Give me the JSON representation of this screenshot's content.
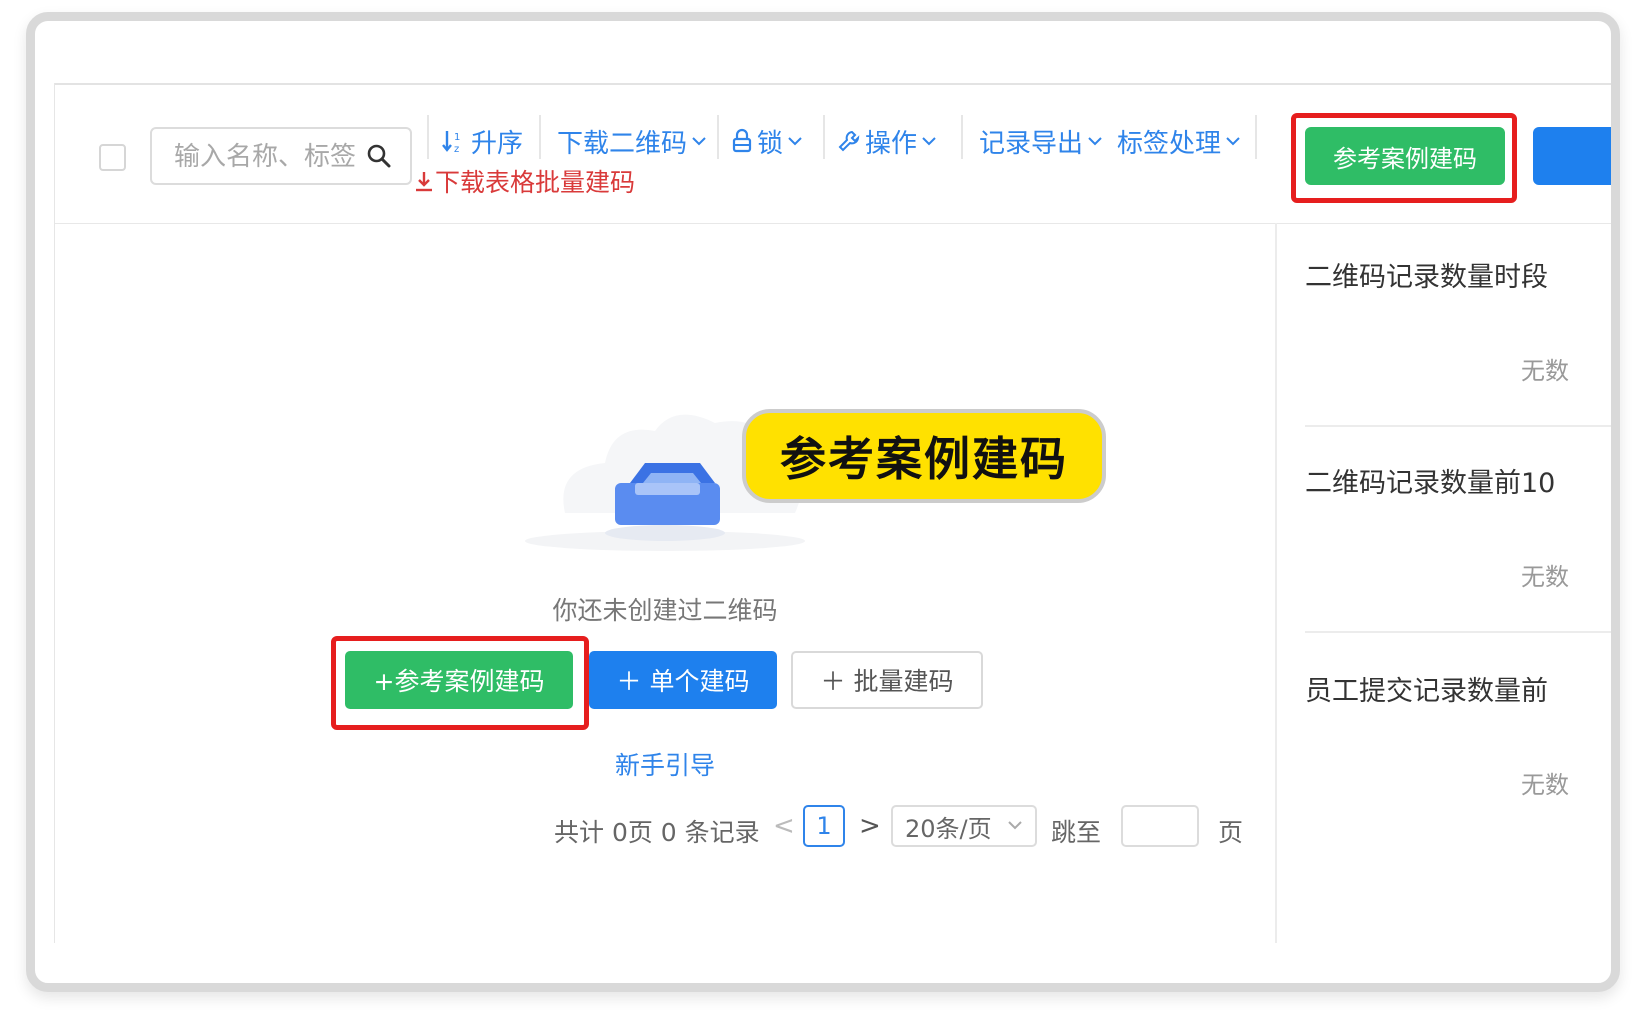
{
  "toolbar": {
    "search_placeholder": "输入名称、标签",
    "sort_label": "升序",
    "download_qr_label": "下载二维码",
    "lock_label": "锁",
    "operate_label": "操作",
    "export_label": "记录导出",
    "tag_label": "标签处理",
    "download_sheet_label": "下载表格批量建码",
    "reference_case_label": "参考案例建码"
  },
  "callout": {
    "text": "参考案例建码"
  },
  "empty_state": {
    "message": "你还未创建过二维码",
    "reference_case_button": "+参考案例建码",
    "single_button": "＋ 单个建码",
    "batch_button": "＋ 批量建码",
    "guide_link": "新手引导"
  },
  "pagination": {
    "total_text": "共计 0页 0 条记录",
    "prev": "<",
    "current_page": "1",
    "next": ">",
    "page_size": "20条/页",
    "jump_label": "跳至",
    "page_suffix": "页"
  },
  "side_panel": {
    "sections": [
      {
        "title": "二维码记录数量时段",
        "empty": "无数"
      },
      {
        "title": "二维码记录数量前10",
        "empty": "无数"
      },
      {
        "title": "员工提交记录数量前",
        "empty": "无数"
      }
    ]
  },
  "colors": {
    "accent_blue": "#2f84ea",
    "green": "#2fbd66",
    "highlight_red": "#e61e1e",
    "callout_yellow": "#ffe100",
    "link_red": "#d93a3a"
  }
}
